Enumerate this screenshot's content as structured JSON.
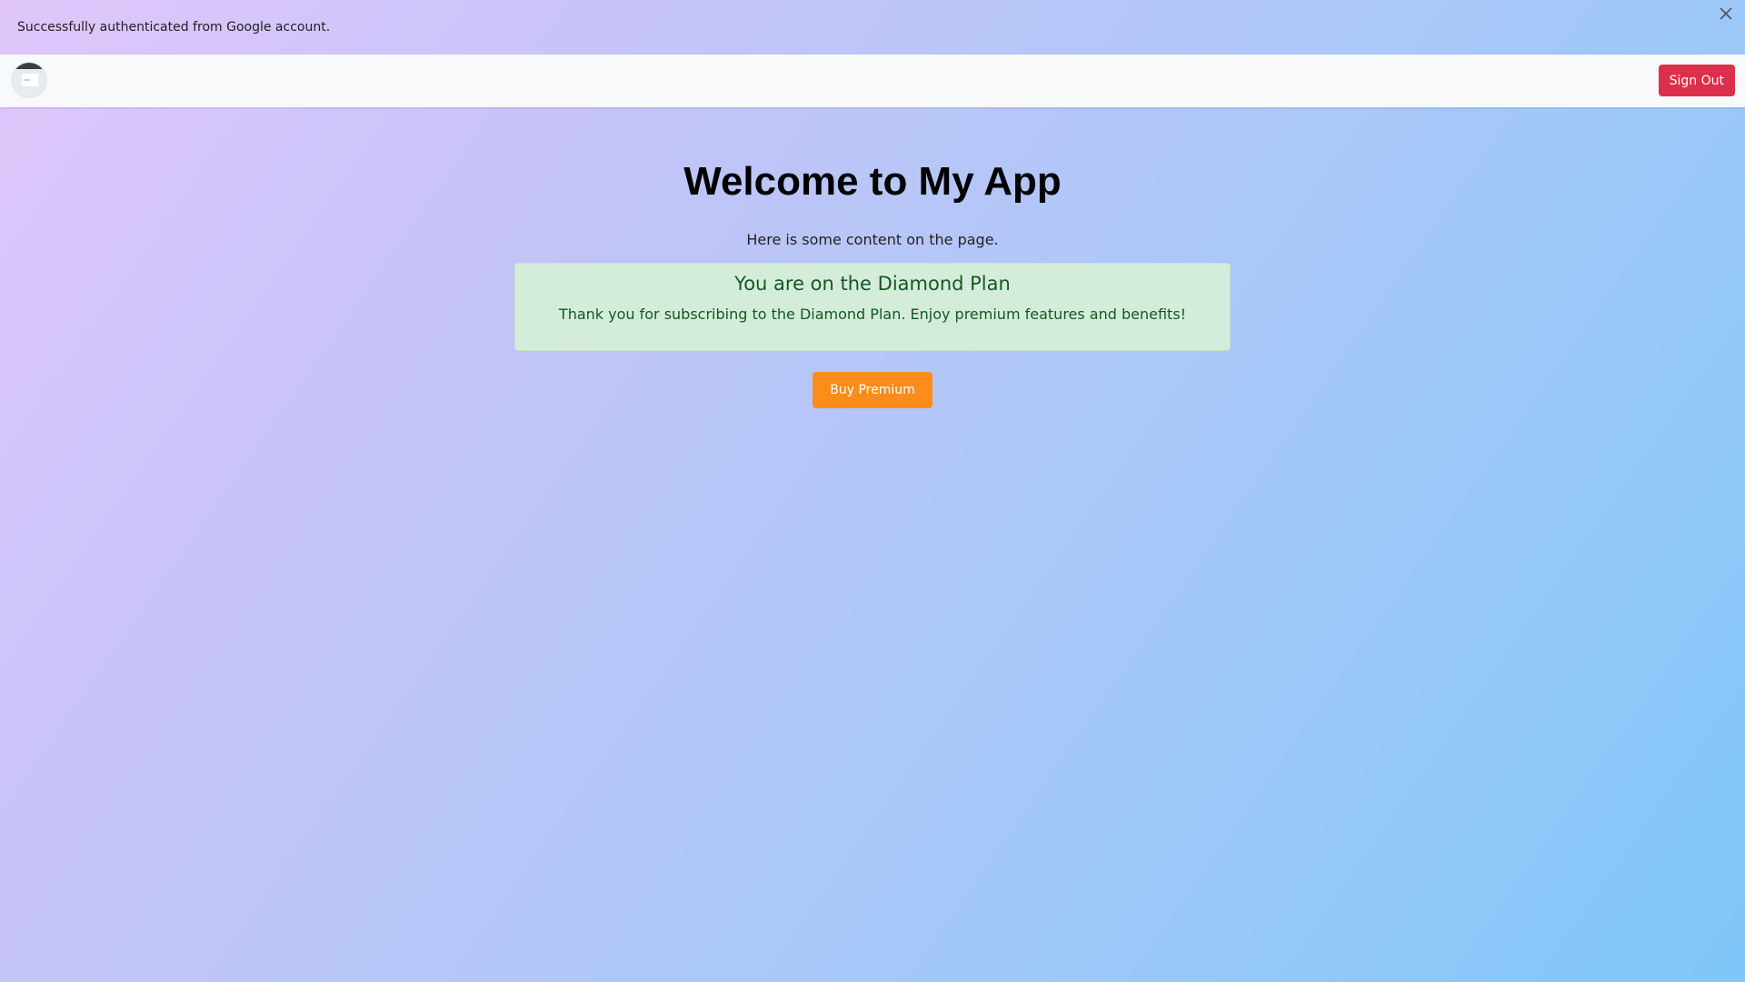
{
  "toast": {
    "message": "Successfully authenticated from Google account.",
    "close_icon": "close-icon"
  },
  "navbar": {
    "avatar_icon": "user-avatar",
    "signout_label": "Sign Out",
    "signout_color": "#dc2f4b"
  },
  "main": {
    "title": "Welcome to My App",
    "subtitle": "Here is some content on the page.",
    "plan": {
      "heading": "You are on the Diamond Plan",
      "message": "Thank you for subscribing to the Diamond Plan. Enjoy premium features and benefits!",
      "bg_color": "#d4edda",
      "text_color": "#155724"
    },
    "buy_label": "Buy Premium",
    "buy_color": "#fd8c1a"
  }
}
